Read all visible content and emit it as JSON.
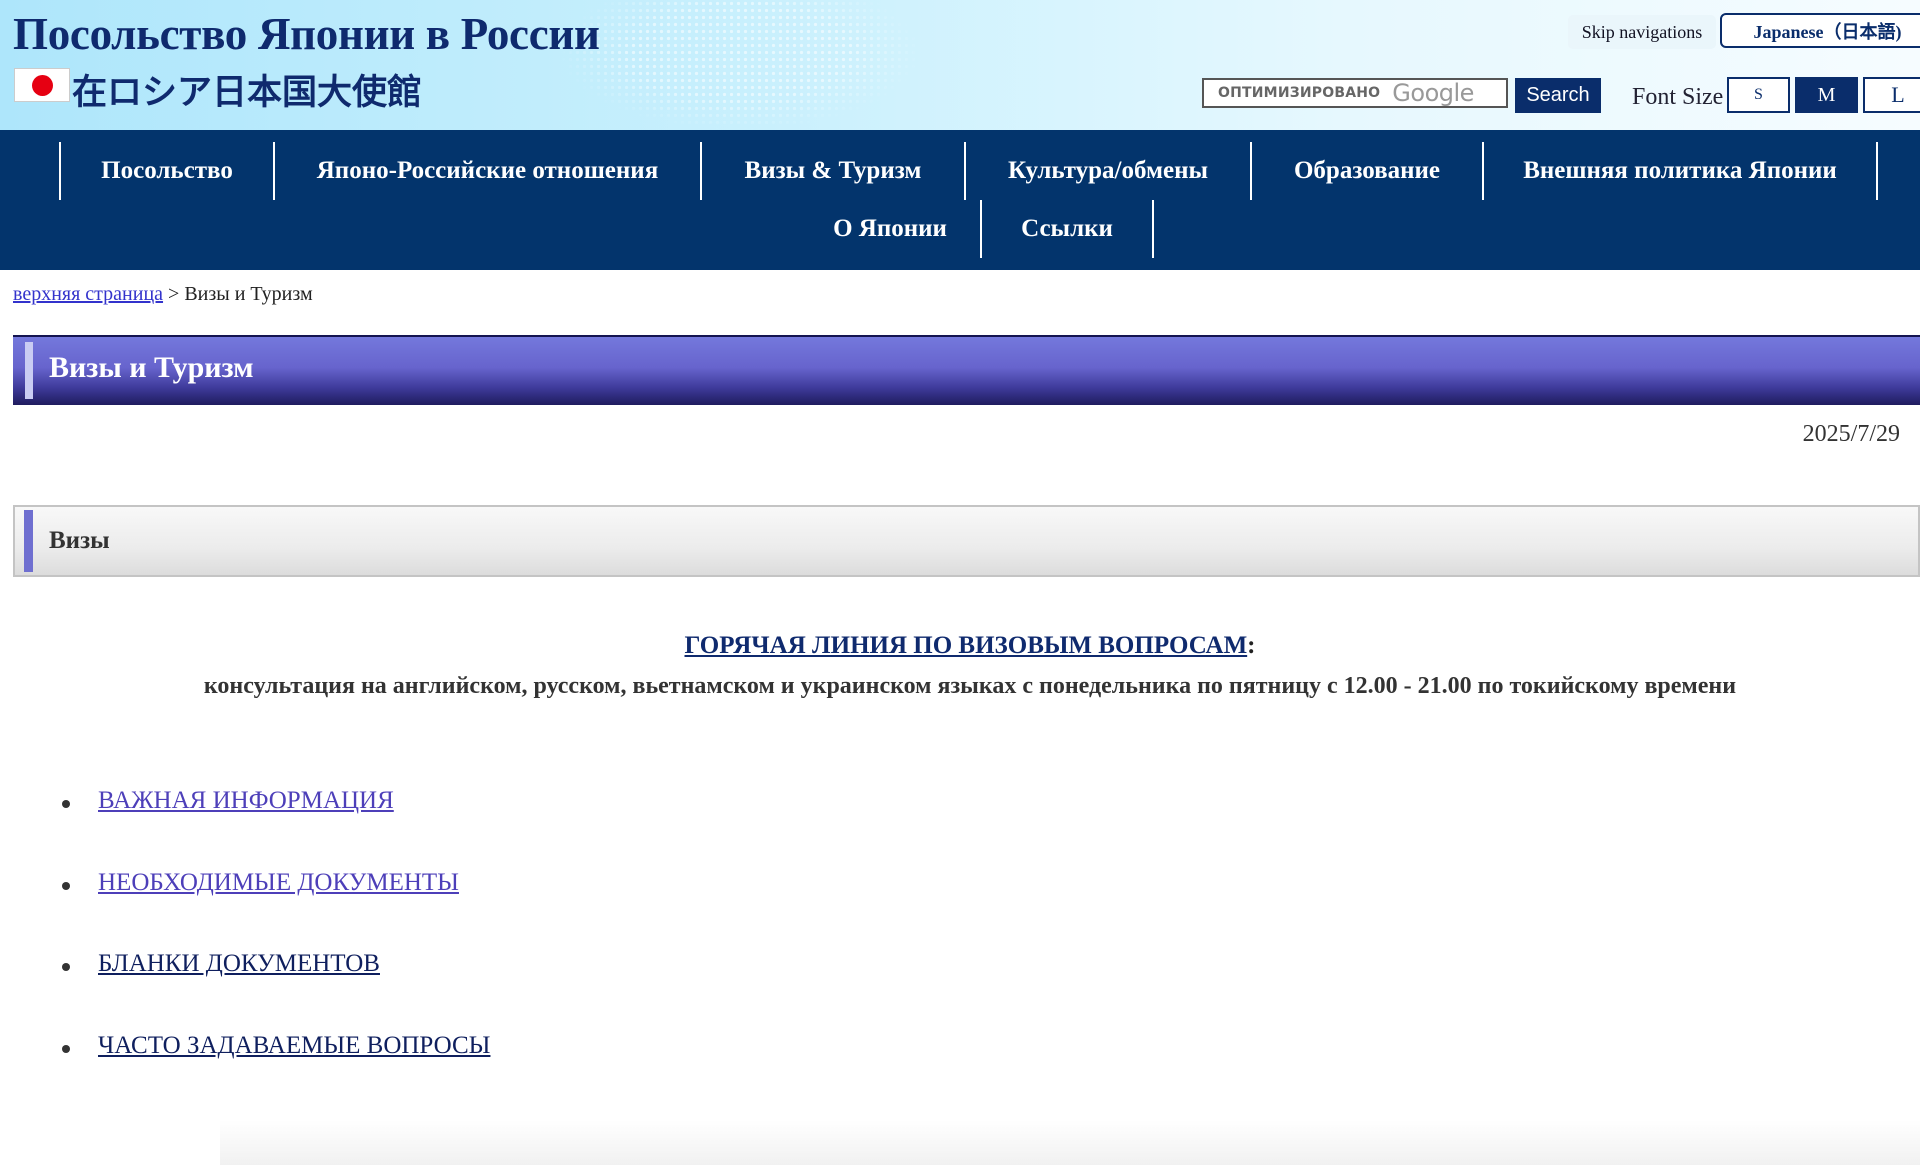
{
  "header": {
    "site_title": "Посольство Японии в России",
    "jp_title": "在ロシア日本国大使館",
    "skip_nav": "Skip navigations",
    "lang_button": "Japanese（日本語)",
    "search_box_text": "ОПТИМИЗИРОВАНО",
    "search_box_brand": "Google",
    "search_button": "Search",
    "font_size_label": "Font Size",
    "font_size_s": "S",
    "font_size_m": "M",
    "font_size_l": "L"
  },
  "nav": {
    "items": [
      "Посольство",
      "Японо-Российские отношения",
      "Визы & Туризм",
      "Культура/обмены",
      "Образование",
      "Внешняя политика Японии",
      "О Японии",
      "Ссылки"
    ]
  },
  "breadcrumb": {
    "home": "верхняя страница",
    "separator": " > ",
    "current": "Визы и Туризм"
  },
  "page": {
    "title": "Визы и Туризм",
    "date": "2025/7/29",
    "section_title": "Визы",
    "hotline_link": "ГОРЯЧАЯ ЛИНИЯ ПО ВИЗОВЫМ ВОПРОСАМ",
    "hotline_colon": ":",
    "hotline_desc": "консультация на английском, русском, вьетнамском и украинском языках с понедельника по пятницу с 12.00 - 21.00 по токийскому времени",
    "links": [
      "ВАЖНАЯ ИНФОРМАЦИЯ",
      "НЕОБХОДИМЫЕ ДОКУМЕНТЫ",
      "БЛАНКИ ДОКУМЕНТОВ",
      "ЧАСТО ЗАДАВАЕМЫЕ ВОПРОСЫ"
    ]
  },
  "colors": {
    "nav_bg": "#03346c",
    "title_banner": "#6764cd",
    "link_visited": "#4d3fb9",
    "link_default": "#0f1f5e"
  }
}
